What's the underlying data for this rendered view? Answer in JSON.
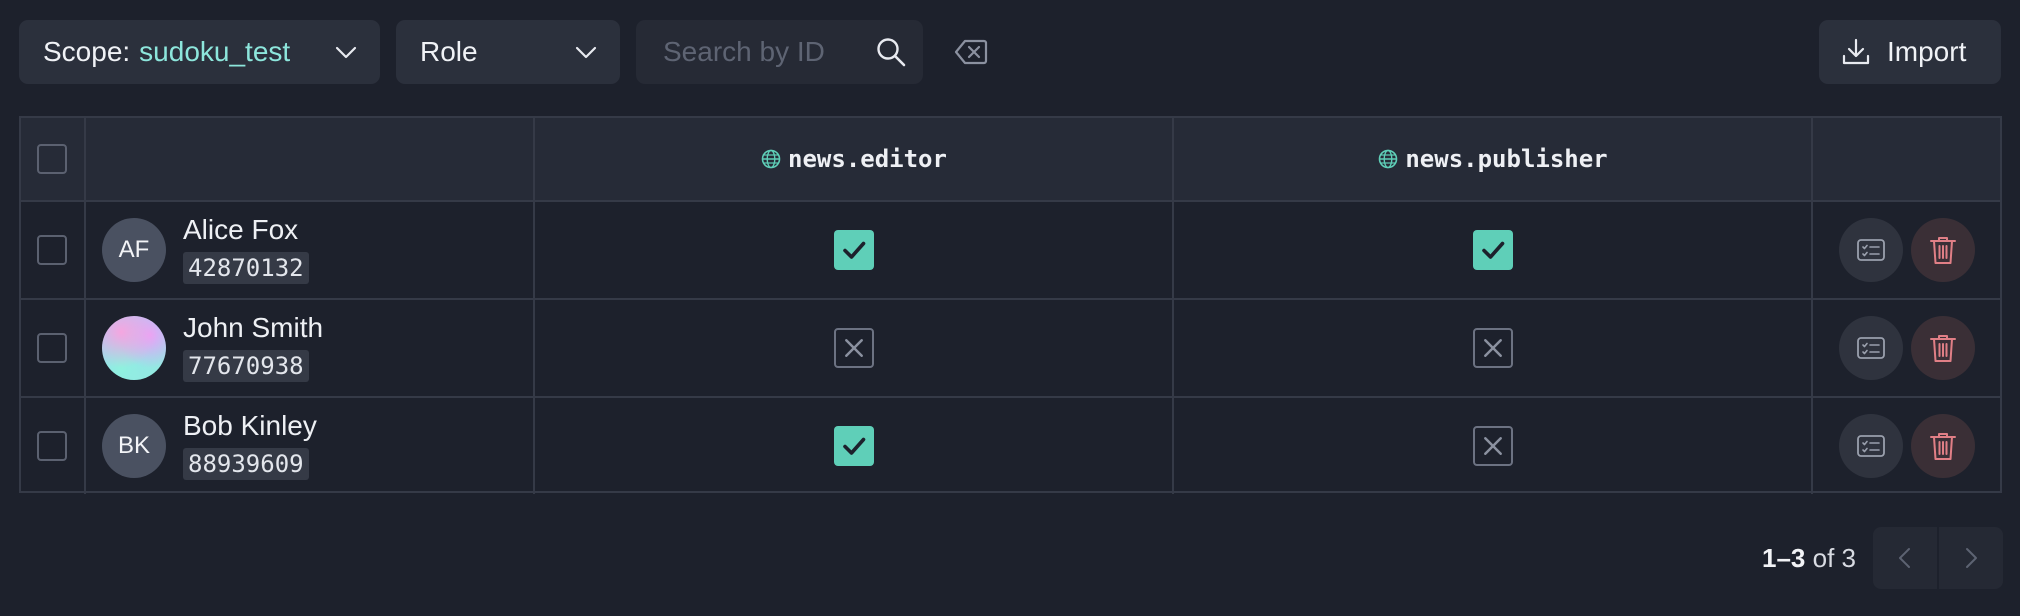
{
  "toolbar": {
    "scope_label": "Scope:",
    "scope_value": "sudoku_test",
    "role_label": "Role",
    "search_placeholder": "Search by ID",
    "search_value": "",
    "import_label": "Import"
  },
  "table": {
    "roles": [
      "news.editor",
      "news.publisher"
    ],
    "users": [
      {
        "name": "Alice Fox",
        "id": "42870132",
        "initials": "AF",
        "avatar": "initials",
        "permissions": [
          true,
          true
        ]
      },
      {
        "name": "John Smith",
        "id": "77670938",
        "initials": "",
        "avatar": "gradient-image",
        "permissions": [
          false,
          false
        ]
      },
      {
        "name": "Bob Kinley",
        "id": "88939609",
        "initials": "BK",
        "avatar": "initials",
        "permissions": [
          true,
          false
        ]
      }
    ]
  },
  "pagination": {
    "range": "1–3",
    "of_label": "of",
    "total": "3"
  },
  "colors": {
    "background": "#1d212c",
    "accent": "#8de6dc",
    "check_on": "#5fcfb8",
    "delete": "#e07f86"
  },
  "icons": [
    "chevron-down-icon",
    "search-icon",
    "clear-icon",
    "download-icon",
    "globe-icon",
    "check-icon",
    "x-icon",
    "details-icon",
    "trash-icon",
    "chevron-left-icon",
    "chevron-right-icon"
  ]
}
